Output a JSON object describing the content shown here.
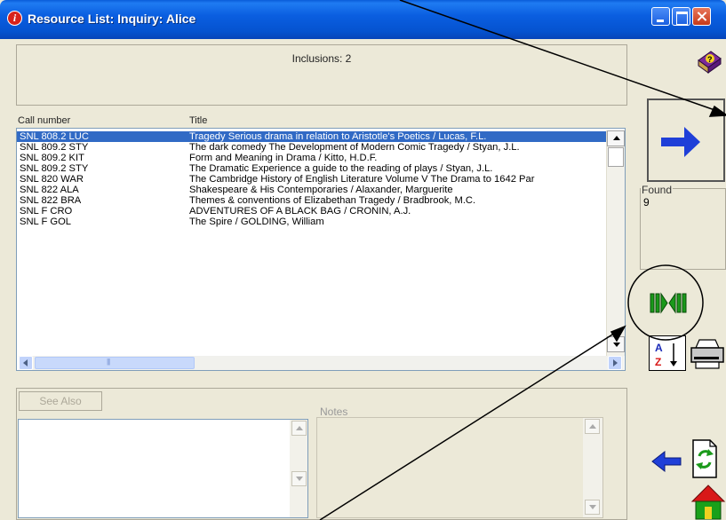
{
  "window": {
    "title": "Resource List: Inquiry: Alice"
  },
  "inclusions": {
    "text": "Inclusions: 2"
  },
  "list": {
    "columns": [
      "Call number",
      "Title"
    ],
    "rows": [
      {
        "call": "SNL 808.2 LUC",
        "title": "Tragedy Serious drama in relation to Aristotle's Poetics / Lucas, F.L.",
        "selected": true
      },
      {
        "call": "SNL 809.2 STY",
        "title": "The dark comedy The Development of Modern Comic Tragedy / Styan, J.L."
      },
      {
        "call": "SNL 809.2 KIT",
        "title": "Form and Meaning in Drama / Kitto, H.D.F."
      },
      {
        "call": "SNL 809.2 STY",
        "title": "The Dramatic Experience a guide to the reading of plays / Styan, J.L."
      },
      {
        "call": "SNL 820 WAR",
        "title": "The Cambridge History of English Literature Volume V The Drama to 1642 Par"
      },
      {
        "call": "SNL 822 ALA",
        "title": "Shakespeare & His Contemporaries / Alaxander, Marguerite"
      },
      {
        "call": "SNL 822 BRA",
        "title": "Themes & conventions of Elizabethan Tragedy / Bradbrook, M.C."
      },
      {
        "call": "SNL F CRO",
        "title": "ADVENTURES OF A BLACK BAG / CRONIN, A.J."
      },
      {
        "call": "SNL F GOL",
        "title": "The Spire / GOLDING, William"
      }
    ]
  },
  "found": {
    "label": "Found",
    "value": "9"
  },
  "lower": {
    "see_also": "See Also",
    "notes": "Notes"
  },
  "icons": {
    "help": "help-book-icon",
    "go": "forward-arrow-icon",
    "compare": "split-columns-icon",
    "sort": "sort-az-icon",
    "print": "printer-icon",
    "back": "back-arrow-icon",
    "refresh": "refresh-document-icon",
    "home": "home-icon"
  },
  "colors": {
    "titlebar": "#0a5ee0",
    "selection": "#316ac5",
    "accent_arrow": "#1f3fd8",
    "compare_green": "#1a9a1a"
  }
}
